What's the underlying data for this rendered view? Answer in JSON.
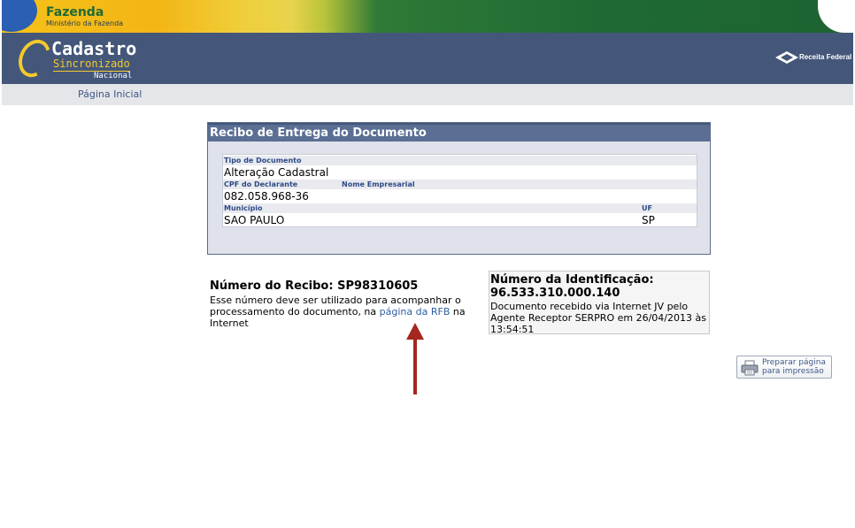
{
  "banner": {
    "org_name": "Fazenda",
    "ministry": "Ministério da Fazenda"
  },
  "header": {
    "logo_line1": "Cadastro",
    "logo_line2": "Sincronizado",
    "logo_line3": "Nacional",
    "partner_label": "Receita Federal"
  },
  "nav": {
    "home_link": "Página Inicial"
  },
  "receipt": {
    "title": "Recibo de Entrega do Documento",
    "doc_type_label": "Tipo de Documento",
    "doc_type_value": "Alteração Cadastral",
    "cpf_label": "CPF do Declarante",
    "company_name_label": "Nome Empresarial",
    "cpf_value": "082.058.968-36",
    "company_name_value": "",
    "municipality_label": "Município",
    "uf_label": "UF",
    "municipality_value": "SAO PAULO",
    "uf_value": "SP"
  },
  "receipt_number": {
    "text": "Número do Recibo: SP98310605",
    "desc_before": "Esse número deve ser utilizado para acompanhar o processamento do documento, na ",
    "link": "página da RFB",
    "desc_after": " na Internet"
  },
  "identification": {
    "title": "Número da Identificação:",
    "number": "96.533.310.000.140",
    "desc": "Documento recebido via Internet JV pelo Agente Receptor SERPRO em 26/04/2013 às 13:54:51"
  },
  "print_button": {
    "label_line1": "Preparar página",
    "label_line2": "para impressão"
  },
  "colors": {
    "header_blue": "#44577a",
    "panel_title": "#5a6f93",
    "arrow": "#a5271d",
    "link": "#2e5ea0"
  }
}
